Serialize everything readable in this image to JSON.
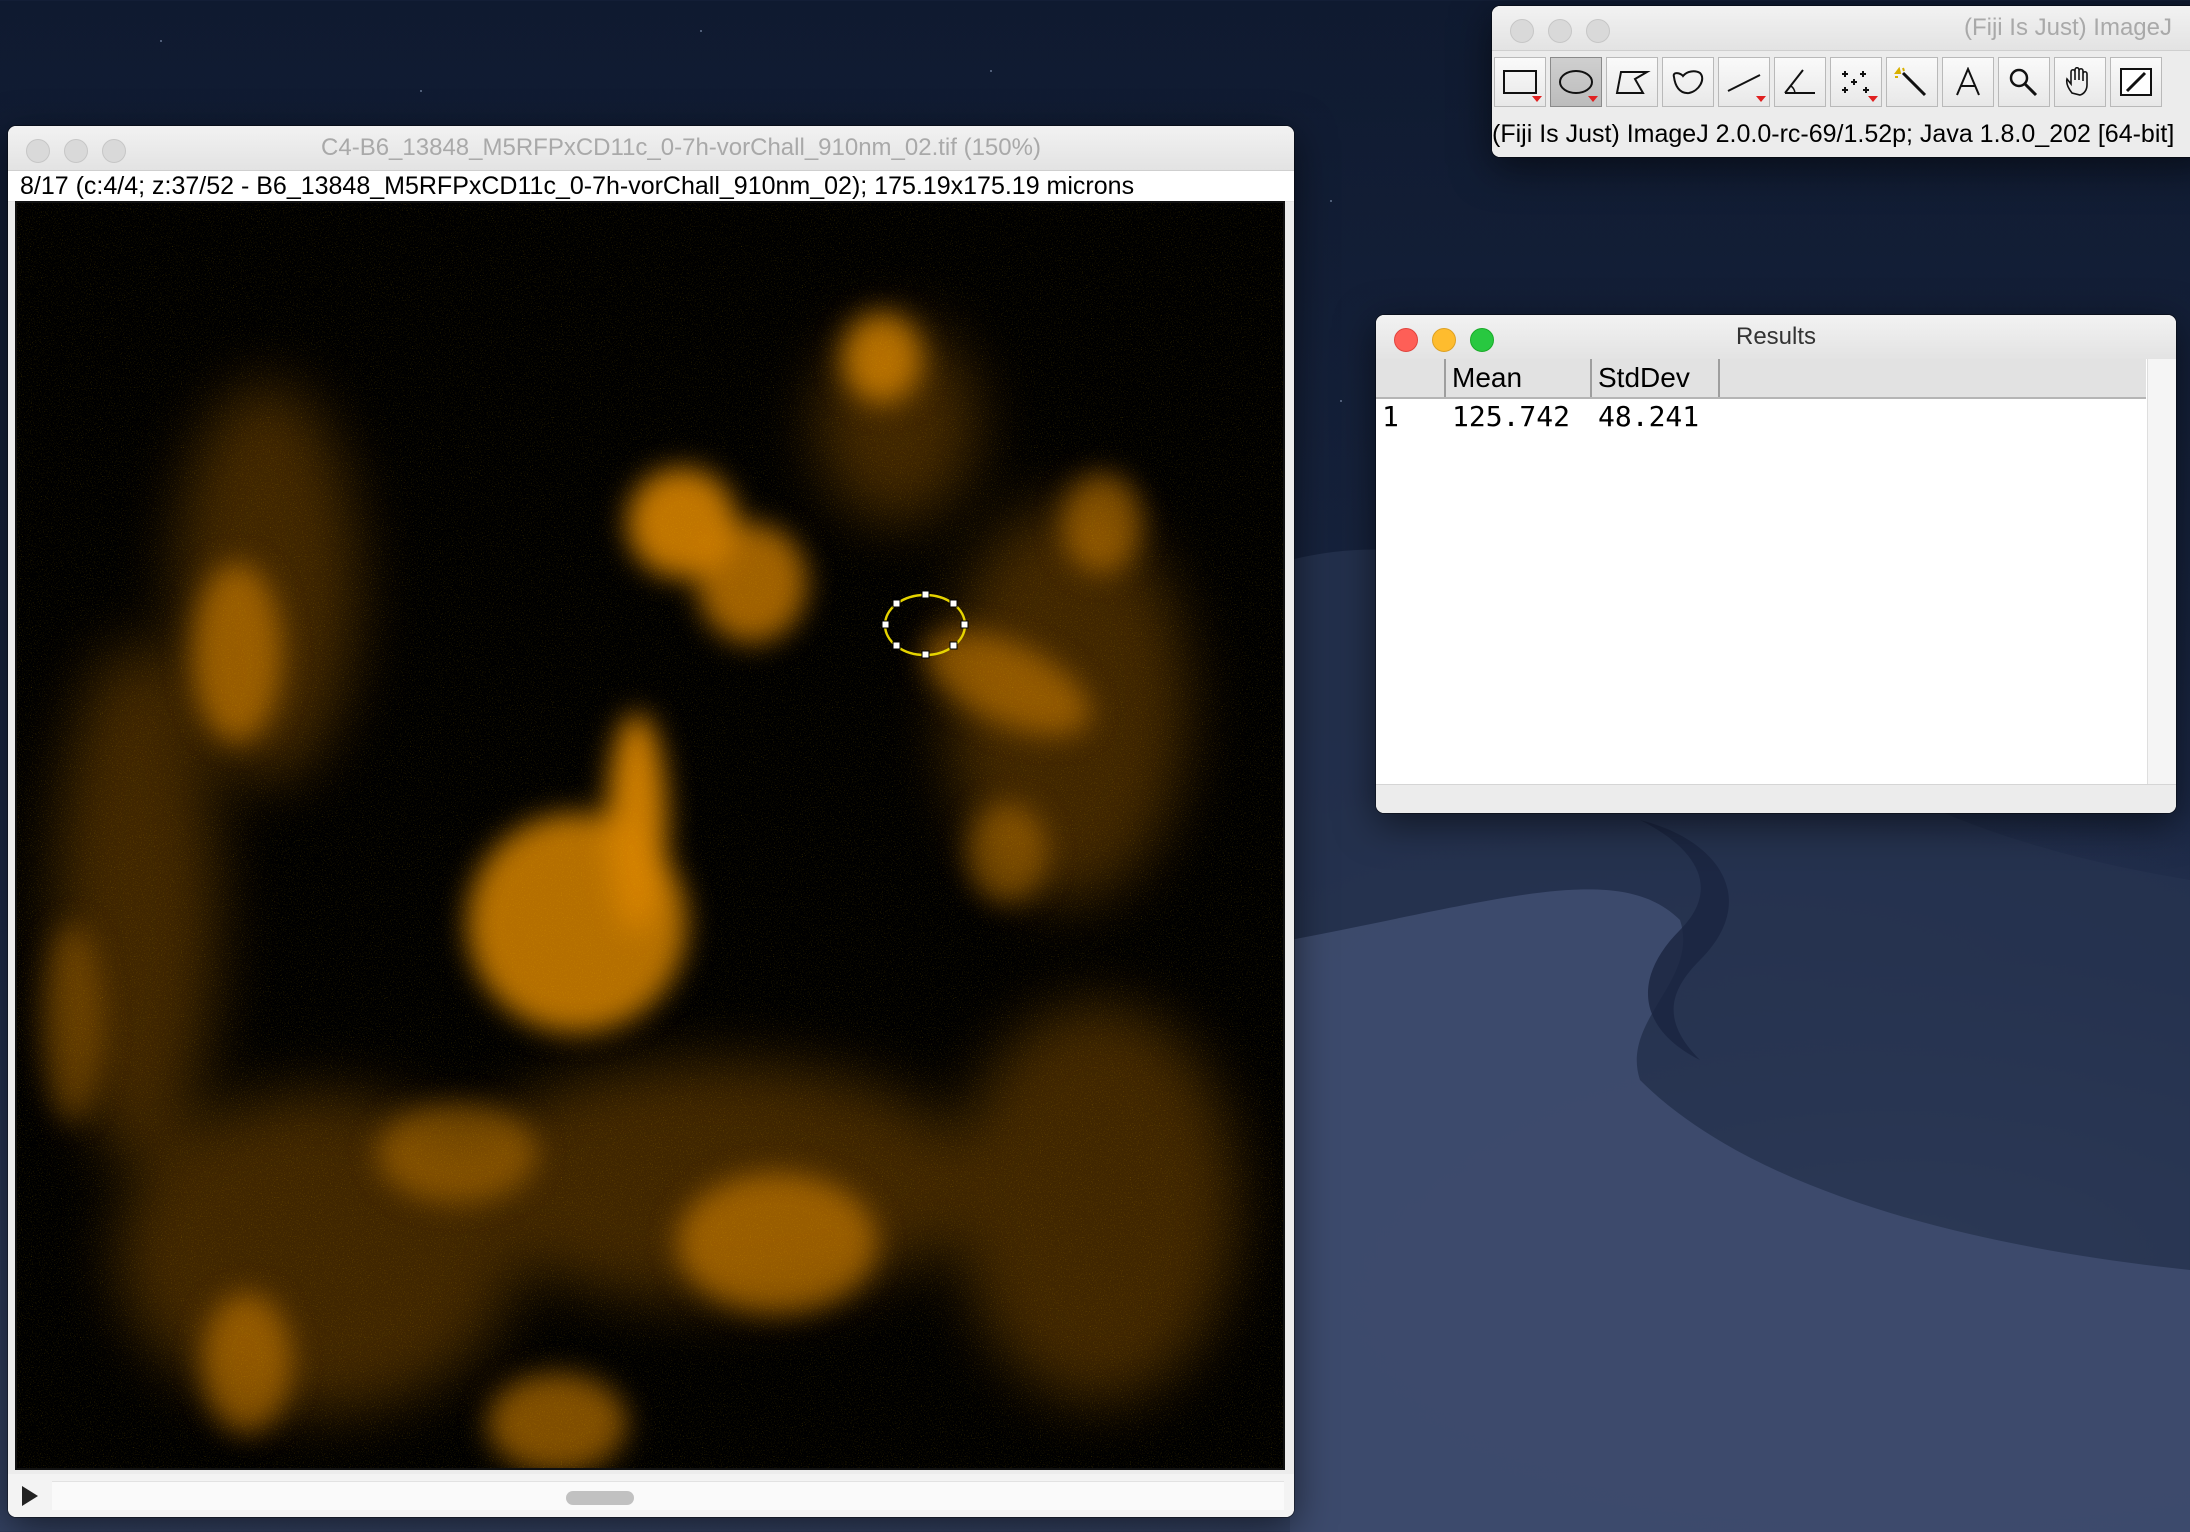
{
  "image_window": {
    "title": "C4-B6_13848_M5RFPxCD11c_0-7h-vorChall_910nm_02.tif (150%)",
    "subtitle": "8/17 (c:4/4; z:37/52 - B6_13848_M5RFPxCD11c_0-7h-vorChall_910nm_02); 175.19x175.19 microns",
    "lut_color": "#ff9a00"
  },
  "imagej_window": {
    "title": "(Fiji Is Just) ImageJ",
    "status": "(Fiji Is Just) ImageJ 2.0.0-rc-69/1.52p; Java 1.8.0_202 [64-bit]",
    "tools": [
      {
        "name": "rectangle-tool-icon",
        "selected": false,
        "has_menu": true
      },
      {
        "name": "oval-tool-icon",
        "selected": true,
        "has_menu": true
      },
      {
        "name": "polygon-tool-icon",
        "selected": false,
        "has_menu": false
      },
      {
        "name": "freehand-tool-icon",
        "selected": false,
        "has_menu": false
      },
      {
        "name": "line-tool-icon",
        "selected": false,
        "has_menu": true
      },
      {
        "name": "angle-tool-icon",
        "selected": false,
        "has_menu": false
      },
      {
        "name": "point-tool-icon",
        "selected": false,
        "has_menu": true
      },
      {
        "name": "wand-tool-icon",
        "selected": false,
        "has_menu": false
      },
      {
        "name": "text-tool-icon",
        "selected": false,
        "has_menu": false
      },
      {
        "name": "magnifier-tool-icon",
        "selected": false,
        "has_menu": false
      },
      {
        "name": "hand-tool-icon",
        "selected": false,
        "has_menu": false
      },
      {
        "name": "dropper-tool-icon",
        "selected": false,
        "has_menu": false
      }
    ]
  },
  "results_window": {
    "title": "Results",
    "columns": [
      "",
      "Mean",
      "StdDev"
    ],
    "rows": [
      {
        "index": "1",
        "mean": "125.742",
        "stddev": "48.241"
      }
    ]
  }
}
